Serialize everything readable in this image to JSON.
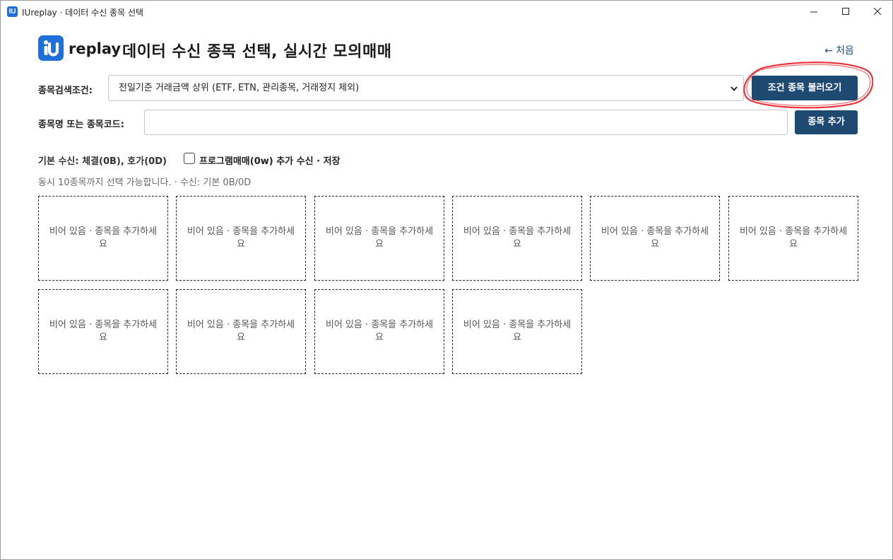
{
  "window": {
    "title": "IUreplay · 데이터 수신 종목 선택",
    "app_icon_text": "IU",
    "controls": [
      "minimize-icon",
      "maximize-icon",
      "close-icon"
    ]
  },
  "header": {
    "brand": "replay",
    "title": "데이터 수신 종목 선택, 실시간 모의매매",
    "back_link": "← 처음"
  },
  "search": {
    "label": "종목검색조건:",
    "selected": "전일기준 거래금액 상위 (ETF, ETN, 관리종목, 거래정지 제외)",
    "load_button": "조건 종목 불러오기"
  },
  "add": {
    "label": "종목명 또는 종목코드:",
    "input_value": "",
    "placeholder": "",
    "add_button": "종목 추가"
  },
  "reception": {
    "base_info": "기본 수신: 체결(0B), 호가(0D)",
    "program_checkbox_label": "프로그램매매(0w) 추가 수신 · 저장",
    "program_checked": false,
    "hint": "동시 10종목까지 선택 가능합니다. · 수신: 기본 0B/0D"
  },
  "slots": [
    "비어 있음 · 종목을 추가하세요",
    "비어 있음 · 종목을 추가하세요",
    "비어 있음 · 종목을 추가하세요",
    "비어 있음 · 종목을 추가하세요",
    "비어 있음 · 종목을 추가하세요",
    "비어 있음 · 종목을 추가하세요",
    "비어 있음 · 종목을 추가하세요",
    "비어 있음 · 종목을 추가하세요",
    "비어 있음 · 종목을 추가하세요",
    "비어 있음 · 종목을 추가하세요"
  ],
  "colors": {
    "primary": "#1e4a72",
    "brand_blue": "#1f6fd8",
    "annotation_red": "#e8333a"
  }
}
